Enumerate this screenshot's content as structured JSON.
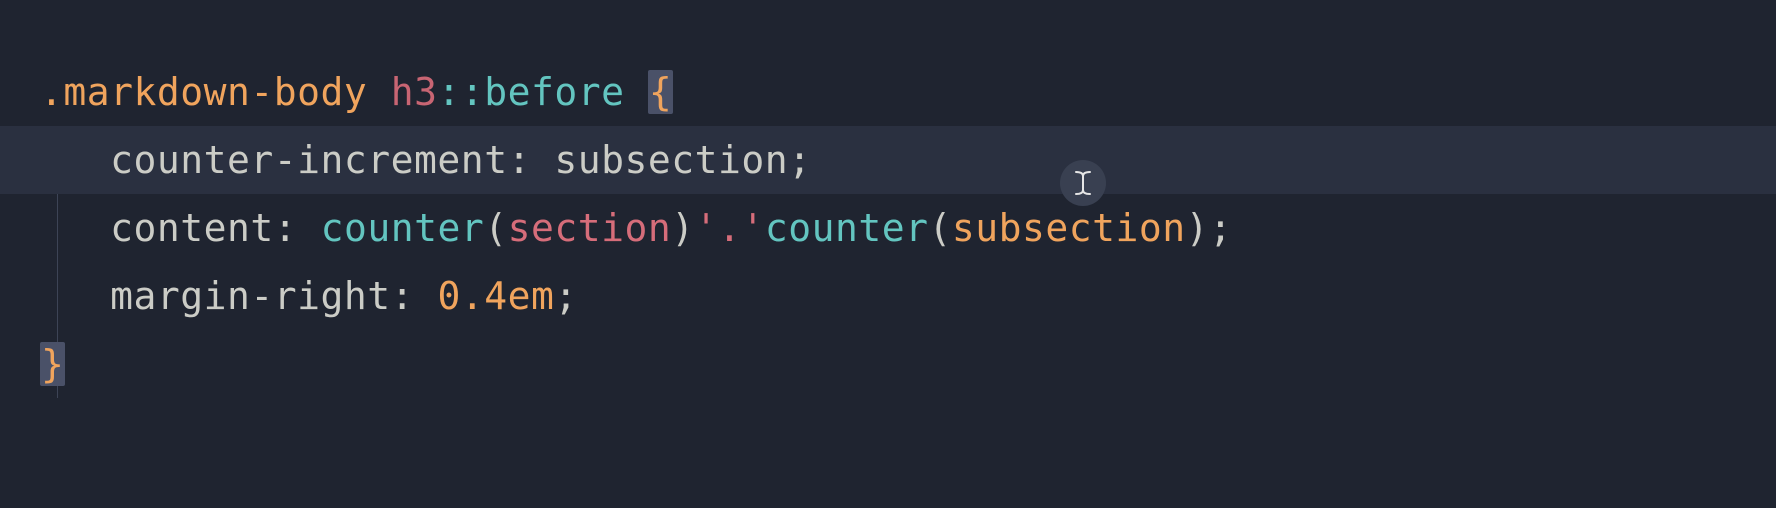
{
  "code": {
    "line1": {
      "class": ".markdown-body",
      "tag": "h3",
      "colon": "::",
      "pseudo": "before",
      "brace_open": "{"
    },
    "line2": {
      "indent": "   ",
      "prop": "counter-increment",
      "colon": ":",
      "space": " ",
      "val": "subsection",
      "semi": ";"
    },
    "line3": {
      "indent": "   ",
      "prop": "content",
      "colon": ":",
      "space": " ",
      "func1": "counter",
      "paren1_open": "(",
      "arg1": "section",
      "paren1_close": ")",
      "str": "'.'",
      "func2": "counter",
      "paren2_open": "(",
      "arg2": "subsection",
      "paren2_close": ")",
      "semi": ";"
    },
    "line4": {
      "indent": "   ",
      "prop": "margin-right",
      "colon": ":",
      "space": " ",
      "num": "0.4em",
      "semi": ";"
    },
    "line5": {
      "brace_close": "}"
    }
  }
}
